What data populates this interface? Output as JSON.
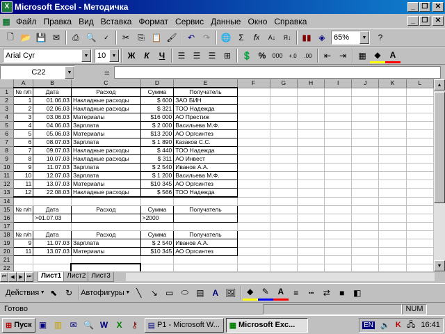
{
  "window": {
    "title": "Microsoft Excel - Методичка"
  },
  "menu": [
    "Файл",
    "Правка",
    "Вид",
    "Вставка",
    "Формат",
    "Сервис",
    "Данные",
    "Окно",
    "Справка"
  ],
  "toolbar": {
    "zoom": "65%"
  },
  "format": {
    "font": "Arial Cyr",
    "size": "10",
    "bold": "Ж",
    "italic": "К",
    "underline": "Ч",
    "percent": "%",
    "thousands": "000"
  },
  "formula": {
    "cell_ref": "C22",
    "eq": "="
  },
  "columns": [
    "A",
    "B",
    "C",
    "D",
    "E",
    "F",
    "G",
    "H",
    "I",
    "J",
    "K",
    "L"
  ],
  "rows": [
    [
      "№ п/п",
      "Дата",
      "Расход",
      "Сумма",
      "Получатель"
    ],
    [
      "1",
      "01.06.03",
      "Накладные расходы",
      "$     600",
      "ЗАО БИН"
    ],
    [
      "2",
      "02.06.03",
      "Накладные расходы",
      "$     321",
      "ТОО Надежда"
    ],
    [
      "3",
      "03.06.03",
      "Материалы",
      "$16 000",
      "АО Престиж"
    ],
    [
      "4",
      "04.06.03",
      "Зарплата",
      "$  2 000",
      "Васильева М.Ф."
    ],
    [
      "5",
      "05.06.03",
      "Материалы",
      "$13 200",
      "АО Оргсинтез"
    ],
    [
      "6",
      "08.07.03",
      "Зарплата",
      "$  1 890",
      "Казаков  С.С."
    ],
    [
      "7",
      "09.07.03",
      "Накладные расходы",
      "$     440",
      "ТОО Надежда"
    ],
    [
      "8",
      "10.07.03",
      "Накладные расходы",
      "$     311",
      "АО Инвест"
    ],
    [
      "9",
      "11.07.03",
      "Зарплата",
      "$  2 540",
      "Иванов  А.А."
    ],
    [
      "10",
      "12.07.03",
      "Зарплата",
      "$  1 200",
      "Васильева М.Ф."
    ],
    [
      "11",
      "13.07.03",
      "Материалы",
      "$10 345",
      "АО Оргсинтез"
    ],
    [
      "12",
      "22.08.03",
      "Накладные расходы",
      "$     566",
      "ТОО Надежда"
    ],
    [
      "",
      "",
      "",
      "",
      ""
    ],
    [
      "№ п/п",
      "Дата",
      "Расход",
      "Сумма",
      "Получатель"
    ],
    [
      "",
      ">01.07.03",
      "",
      ">2000",
      ""
    ],
    [
      "",
      "",
      "",
      "",
      ""
    ],
    [
      "№ п/п",
      "Дата",
      "Расход",
      "Сумма",
      "Получатель"
    ],
    [
      "9",
      "11.07.03",
      "Зарплата",
      "$  2 540",
      "Иванов  А.А."
    ],
    [
      "11",
      "13.07.03",
      "Материалы",
      "$10 345",
      "АО Оргсинтез"
    ],
    [
      "",
      "",
      "",
      "",
      ""
    ],
    [
      "",
      "",
      "",
      "",
      ""
    ],
    [
      "",
      "",
      "",
      "",
      ""
    ]
  ],
  "sheets": [
    "Лист1",
    "Лист2",
    "Лист3"
  ],
  "drawing": {
    "actions": "Действия",
    "autoshapes": "Автофигуры"
  },
  "status": {
    "text": "Готово",
    "num": "NUM"
  },
  "taskbar": {
    "start": "Пуск",
    "items": [
      "P1 - Microsoft W...",
      "Microsoft Exc..."
    ],
    "lang": "EN",
    "clock": "16:41"
  }
}
